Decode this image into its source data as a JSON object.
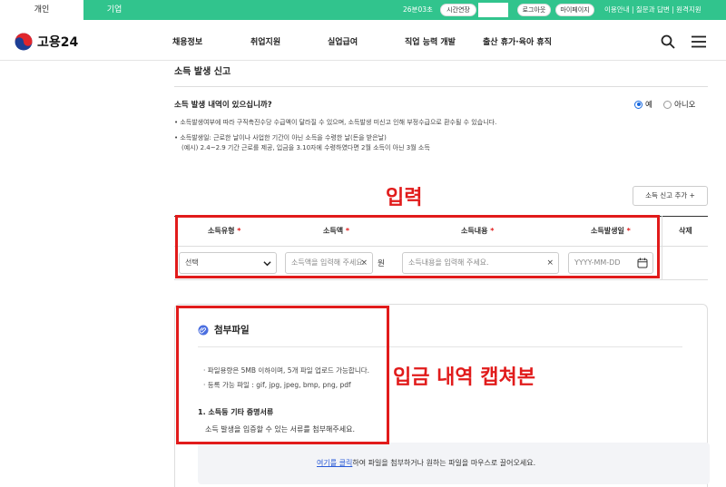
{
  "topbar": {
    "tab_personal": "개인",
    "tab_business": "기업",
    "session_time": "26분03초",
    "extend_label": "시간연장",
    "logout_label": "로그아웃",
    "mypage_label": "마이페이지",
    "util_links": "이용안내 | 질문과 답변 | 원격지원"
  },
  "header": {
    "logo_text": "고용24",
    "nav": [
      "채용정보",
      "취업지원",
      "실업급여",
      "직업 능력 개발",
      "출산 휴가·육아 휴직"
    ]
  },
  "section": {
    "title": "소득 발생 신고",
    "question": "소득 발생 내역이 있으십니까?",
    "radio_yes": "예",
    "radio_no": "아니오",
    "notes": [
      "소득발생여부에 따라 구직촉진수당 수급액이 달라질 수 있으며, 소득발생 미신고 인해 부정수급으로 환수될 수 있습니다.",
      "소득발생일: 근로한 날이나 사업한 기간이 아닌 소득을 수령한 날(돈을 받은날)",
      "(예시) 2.4~2.9 기간 근로를 제공, 입금을 3.10자에 수령하였다면 2월 소득이 아닌 3월 소득"
    ],
    "add_button": "소득 신고 추가 +"
  },
  "annotations": {
    "input_label": "입력",
    "capture_label": "입금 내역 캡쳐본"
  },
  "table": {
    "headers": [
      "소득유형",
      "소득액",
      "소득내용",
      "소득발생일",
      "삭제"
    ],
    "required_mark": "*",
    "select_value": "선택",
    "amount_placeholder": "소득액을 입력해 주세요.",
    "unit": "원",
    "content_placeholder": "소득내용을 입력해 주세요.",
    "date_placeholder": "YYYY-MM-DD",
    "clear_glyph": "×"
  },
  "attachment": {
    "title": "첨부파일",
    "notes": [
      "파일용량은 5MB 이하이며, 5개 파일 업로드 가능합니다.",
      "등록 가능 파일 : gif, jpg, jpeg, bmp, png, pdf"
    ],
    "bullet": "·",
    "subtitle": "1. 소득등 기타 증명서류",
    "description": "소득 발생을 입증할 수 있는 서류를 첨부해주세요.",
    "drop_link": "여기를 클릭",
    "drop_text": "하여 파일을 첨부하거나 원하는 파일을 마우스로 끌어오세요."
  },
  "colors": {
    "brand_green": "#31c48d",
    "annotation_red": "#e11b1b",
    "link_blue": "#2b5bd7"
  }
}
